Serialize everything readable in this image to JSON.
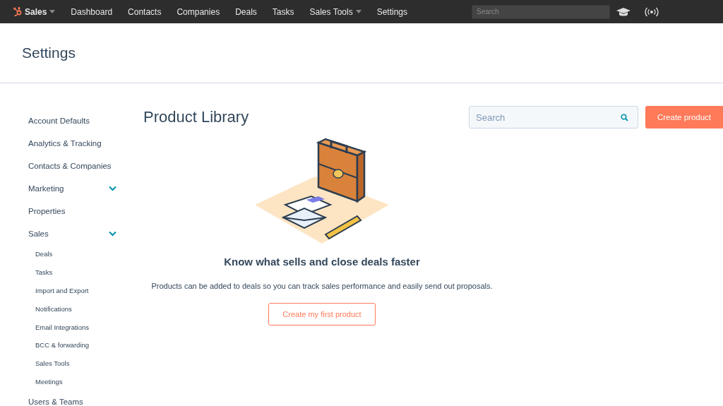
{
  "top_nav": {
    "items": [
      {
        "label": "Sales",
        "dropdown": true,
        "logo": true
      },
      {
        "label": "Dashboard",
        "dropdown": false,
        "logo": false
      },
      {
        "label": "Contacts",
        "dropdown": false,
        "logo": false
      },
      {
        "label": "Companies",
        "dropdown": false,
        "logo": false
      },
      {
        "label": "Deals",
        "dropdown": false,
        "logo": false
      },
      {
        "label": "Tasks",
        "dropdown": false,
        "logo": false
      },
      {
        "label": "Sales Tools",
        "dropdown": true,
        "logo": false
      },
      {
        "label": "Settings",
        "dropdown": false,
        "logo": false
      }
    ],
    "search": {
      "placeholder": "Search"
    }
  },
  "page_title": "Settings",
  "sidebar": {
    "items": [
      {
        "label": "Account Defaults",
        "collapsible": false
      },
      {
        "label": "Analytics & Tracking",
        "collapsible": false
      },
      {
        "label": "Contacts & Companies",
        "collapsible": false
      },
      {
        "label": "Marketing",
        "collapsible": true
      },
      {
        "label": "Properties",
        "collapsible": false
      },
      {
        "label": "Sales",
        "collapsible": true,
        "children": [
          {
            "label": "Deals"
          },
          {
            "label": "Tasks"
          },
          {
            "label": "Import and Export"
          },
          {
            "label": "Notifications"
          },
          {
            "label": "Email Integrations"
          },
          {
            "label": "BCC & forwarding"
          },
          {
            "label": "Sales Tools"
          },
          {
            "label": "Meetings"
          }
        ]
      },
      {
        "label": "Users & Teams",
        "collapsible": false
      }
    ]
  },
  "main": {
    "title": "Product Library",
    "search": {
      "placeholder": "Search"
    },
    "create_button": "Create product",
    "empty_state": {
      "heading": "Know what sells and close deals faster",
      "text": "Products can be added to deals so you can track sales performance and easily send out proposals.",
      "button": "Create my first product"
    }
  }
}
